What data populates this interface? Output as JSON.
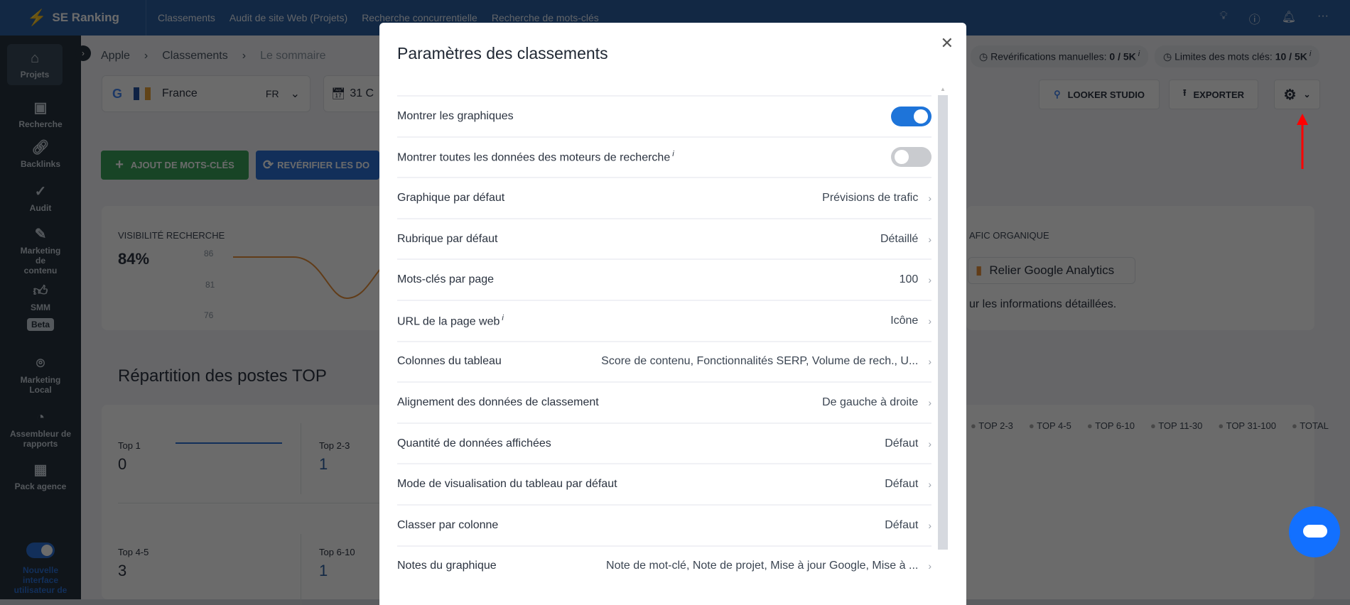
{
  "app": {
    "brand": "SE Ranking",
    "nav": [
      "Classements",
      "Audit de site Web (Projets)",
      "Recherche concurrentielle",
      "Recherche de mots-clés"
    ],
    "icons": [
      "lightbulb-icon",
      "help-icon",
      "bell-icon",
      "more-icon"
    ]
  },
  "sidebar": {
    "items": [
      {
        "label": "Projets",
        "icon": "home-icon"
      },
      {
        "label": "Recherche",
        "icon": "search-monitor-icon"
      },
      {
        "label": "Backlinks",
        "icon": "link-icon"
      },
      {
        "label": "Audit",
        "icon": "check-circle-icon"
      },
      {
        "label": "Marketing de contenu",
        "icon": "edit-icon"
      },
      {
        "label": "SMM",
        "icon": "thumbs-up-icon"
      },
      {
        "label": "Marketing Local",
        "icon": "location-icon"
      },
      {
        "label": "Assembleur de rapports",
        "icon": "pie-chart-icon"
      },
      {
        "label": "Pack agence",
        "icon": "building-icon"
      }
    ],
    "beta": "Beta",
    "new_ui": "Nouvelle interface utilisateur de"
  },
  "breadcrumb": [
    "Apple",
    "Classements",
    "Le sommaire"
  ],
  "filters": {
    "country": "France",
    "lang": "FR",
    "date": "31 C"
  },
  "limits": {
    "manual": "Revérifications manuelles:",
    "manual_val": "0 / 5K",
    "keywords": "Limites des mots clés:",
    "keywords_val": "10 / 5K"
  },
  "toolbar": {
    "looker": "LOOKER STUDIO",
    "export": "EXPORTER"
  },
  "actions": {
    "add": "AJOUT DE MOTS-CLÉS",
    "recheck": "REVÉRIFIER LES DO"
  },
  "visibility": {
    "title": "VISIBILITÉ RECHERCHE",
    "value": "84%",
    "ticks": [
      "86",
      "81",
      "76"
    ]
  },
  "organic": {
    "title": "AFIC ORGANIQUE",
    "button": "Relier Google Analytics",
    "text": "ur les informations détaillées."
  },
  "distribution": {
    "title": "Répartition des postes TOP",
    "tiles": [
      {
        "label": "Top 1",
        "value": "0"
      },
      {
        "label": "Top 2-3",
        "value": "1"
      },
      {
        "label": "Top 4-5",
        "value": "3"
      },
      {
        "label": "Top 6-10",
        "value": "1"
      }
    ],
    "legend": [
      "TOP 2-3",
      "TOP 4-5",
      "TOP 6-10",
      "TOP 11-30",
      "TOP 31-100",
      "TOTAL"
    ]
  },
  "modal": {
    "title": "Paramètres des classements",
    "rows": [
      {
        "label": "Montrer les graphiques",
        "toggle": true
      },
      {
        "label": "Montrer toutes les données des moteurs de recherche",
        "info": "i",
        "toggle": false
      },
      {
        "label": "Graphique par défaut",
        "value": "Prévisions de trafic"
      },
      {
        "label": "Rubrique par défaut",
        "value": "Détaillé"
      },
      {
        "label": "Mots-clés par page",
        "value": "100"
      },
      {
        "label": "URL de la page web",
        "info": "i",
        "value": "Icône"
      },
      {
        "label": "Colonnes du tableau",
        "value": "Score de contenu, Fonctionnalités SERP, Volume de rech., U..."
      },
      {
        "label": "Alignement des données de classement",
        "value": "De gauche à droite"
      },
      {
        "label": "Quantité de données affichées",
        "value": "Défaut"
      },
      {
        "label": "Mode de visualisation du tableau par défaut",
        "value": "Défaut"
      },
      {
        "label": "Classer par colonne",
        "value": "Défaut"
      },
      {
        "label": "Notes du graphique",
        "value": "Note de mot-clé, Note de projet, Mise à jour Google, Mise à ..."
      }
    ]
  },
  "colors": {
    "topbar": "#2a5fa3",
    "sidebar": "#25313d",
    "toggle_on": "#1e74d9",
    "chat": "#1270ff",
    "arrow": "#ff0000"
  }
}
